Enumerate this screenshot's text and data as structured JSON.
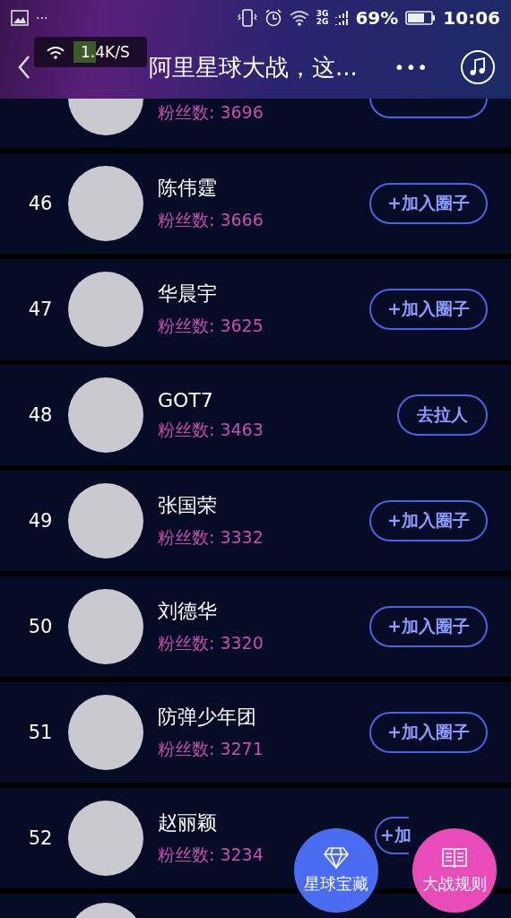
{
  "status_bar": {
    "dots": "···",
    "network_top": "3G",
    "network_bottom": "2G",
    "battery": "69%",
    "time": "10:06"
  },
  "speed_overlay": {
    "speed": "1.4K/S"
  },
  "header": {
    "title": "阿里星球大战，这...",
    "more": "•••"
  },
  "partial_row": {
    "fans": "粉丝数: 3696"
  },
  "rows": [
    {
      "rank": "46",
      "name": "陈伟霆",
      "fans": "粉丝数: 3666",
      "button": "+加入圈子",
      "kind": "join"
    },
    {
      "rank": "47",
      "name": "华晨宇",
      "fans": "粉丝数: 3625",
      "button": "+加入圈子",
      "kind": "join"
    },
    {
      "rank": "48",
      "name": "GOT7",
      "fans": "粉丝数: 3463",
      "button": "去拉人",
      "kind": "invite"
    },
    {
      "rank": "49",
      "name": "张国荣",
      "fans": "粉丝数: 3332",
      "button": "+加入圈子",
      "kind": "join"
    },
    {
      "rank": "50",
      "name": "刘德华",
      "fans": "粉丝数: 3320",
      "button": "+加入圈子",
      "kind": "join"
    },
    {
      "rank": "51",
      "name": "防弹少年团",
      "fans": "粉丝数: 3271",
      "button": "+加入圈子",
      "kind": "join"
    },
    {
      "rank": "52",
      "name": "赵丽颖",
      "fans": "粉丝数: 3234",
      "button": "+加",
      "kind": "join_partial"
    }
  ],
  "floating_buttons": [
    {
      "label": "星球宝藏",
      "kind": "treasure"
    },
    {
      "label": "大战规则",
      "kind": "rules"
    }
  ]
}
